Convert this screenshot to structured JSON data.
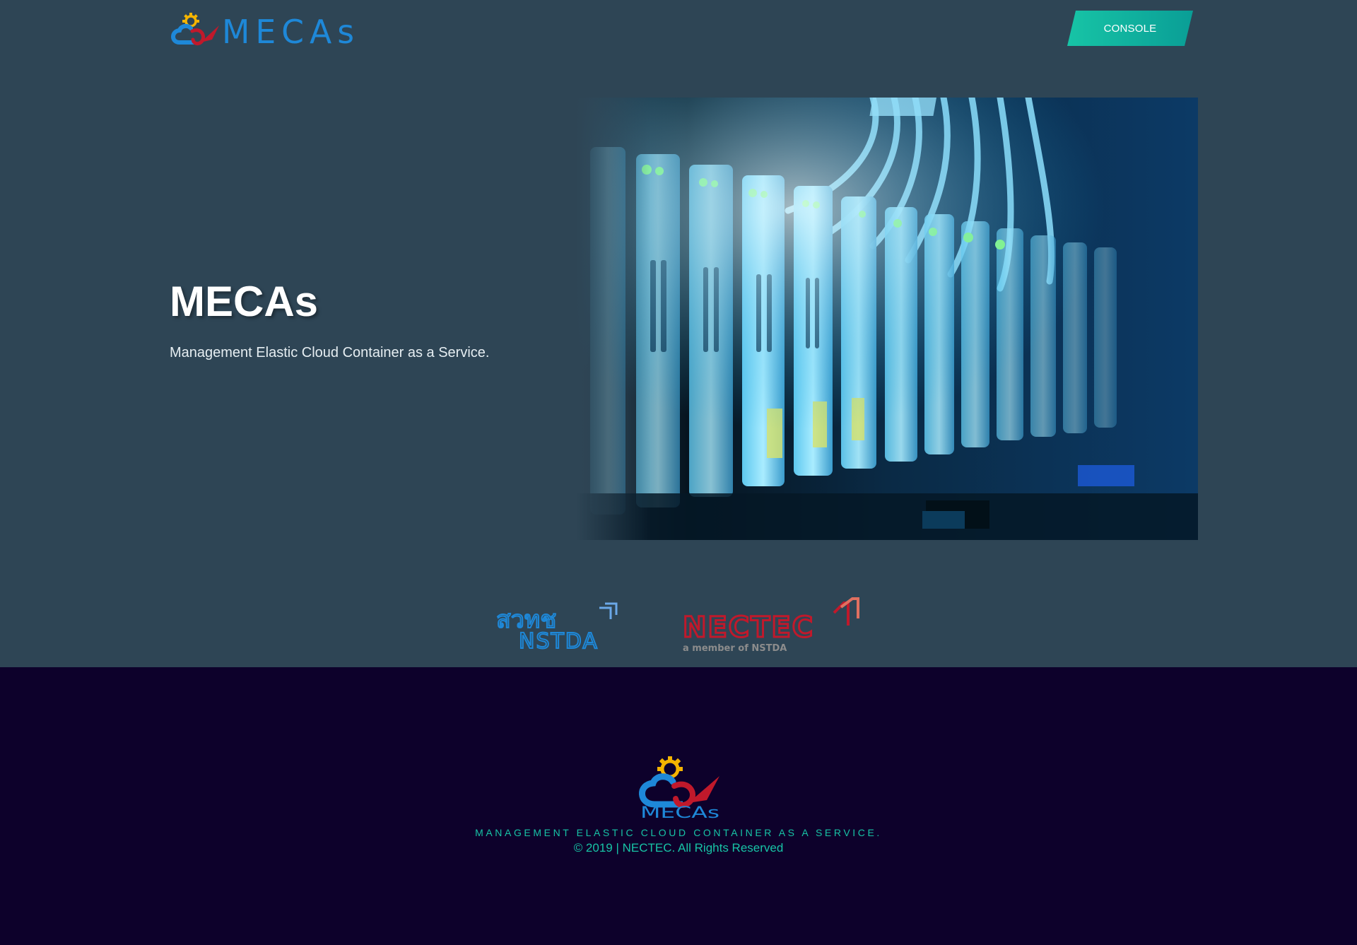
{
  "header": {
    "logo_text": "MECAs",
    "console_label": "CONSOLE"
  },
  "hero": {
    "title": "MECAs",
    "subtitle": "Management Elastic Cloud Container as a Service.",
    "image_alt": "server-rack-photo"
  },
  "partners": {
    "nstda_thai": "สวทช",
    "nstda_text": "NSTDA",
    "nectec_text": "NECTEC",
    "nectec_tagline": "a member of NSTDA"
  },
  "footer": {
    "logo_text": "MECAs",
    "tagline": "MANAGEMENT ELASTIC CLOUD CONTAINER AS A SERVICE.",
    "copyright": "© 2019 | NECTEC. All Rights Reserved"
  },
  "colors": {
    "page_bg": "#2e4555",
    "footer_bg": "#0d012b",
    "accent": "#17c4a6",
    "logo_blue": "#1e88d8",
    "logo_red": "#c0192b",
    "logo_gear": "#f5b400"
  },
  "icons": [
    "mecas-logo-icon",
    "gear-icon",
    "nstda-logo",
    "nectec-logo"
  ]
}
